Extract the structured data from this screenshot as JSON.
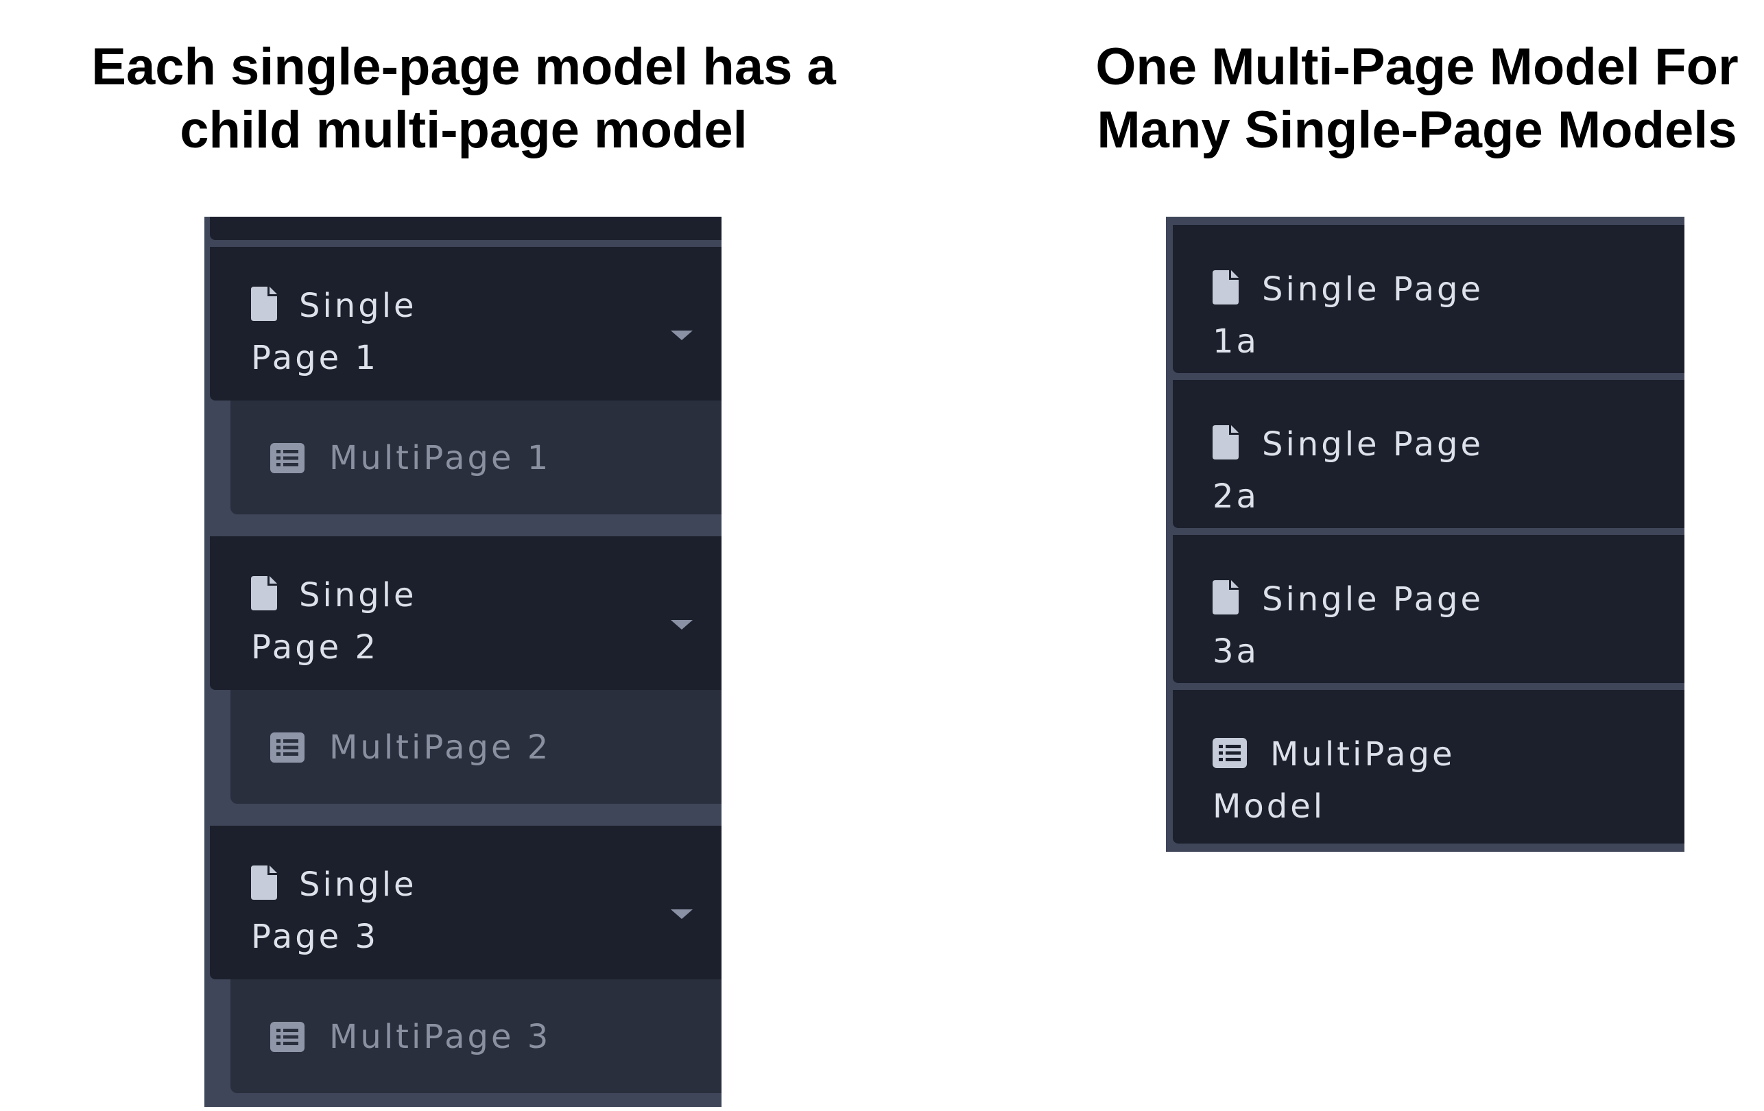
{
  "headings": {
    "left": {
      "line1": "Each single-page model has a",
      "line2": "child multi-page model"
    },
    "right": {
      "line1": "One Multi-Page Model For",
      "line2": "Many Single-Page Models"
    }
  },
  "left_panel": {
    "groups": [
      {
        "parent": {
          "line1": "Single",
          "line2": "Page 1",
          "icon": "file-icon",
          "expanded": true
        },
        "child": {
          "label": "MultiPage 1",
          "icon": "table-list-icon"
        }
      },
      {
        "parent": {
          "line1": "Single",
          "line2": "Page 2",
          "icon": "file-icon",
          "expanded": true
        },
        "child": {
          "label": "MultiPage 2",
          "icon": "table-list-icon"
        }
      },
      {
        "parent": {
          "line1": "Single",
          "line2": "Page 3",
          "icon": "file-icon",
          "expanded": true
        },
        "child": {
          "label": "MultiPage 3",
          "icon": "table-list-icon"
        }
      }
    ]
  },
  "right_panel": {
    "items": [
      {
        "line1": "Single Page",
        "line2": "1a",
        "icon": "file-icon"
      },
      {
        "line1": "Single Page",
        "line2": "2a",
        "icon": "file-icon"
      },
      {
        "line1": "Single Page",
        "line2": "3a",
        "icon": "file-icon"
      },
      {
        "line1": "MultiPage",
        "line2": "Model",
        "icon": "table-list-icon"
      }
    ]
  },
  "colors": {
    "panel_frame": "#3f4659",
    "item_dark": "#1c202c",
    "child_item": "#2a2f3d",
    "text_primary": "#dde1ea",
    "text_muted": "#8a90a0",
    "icon_light": "#c6ccda",
    "icon_muted": "#8f96a8"
  }
}
